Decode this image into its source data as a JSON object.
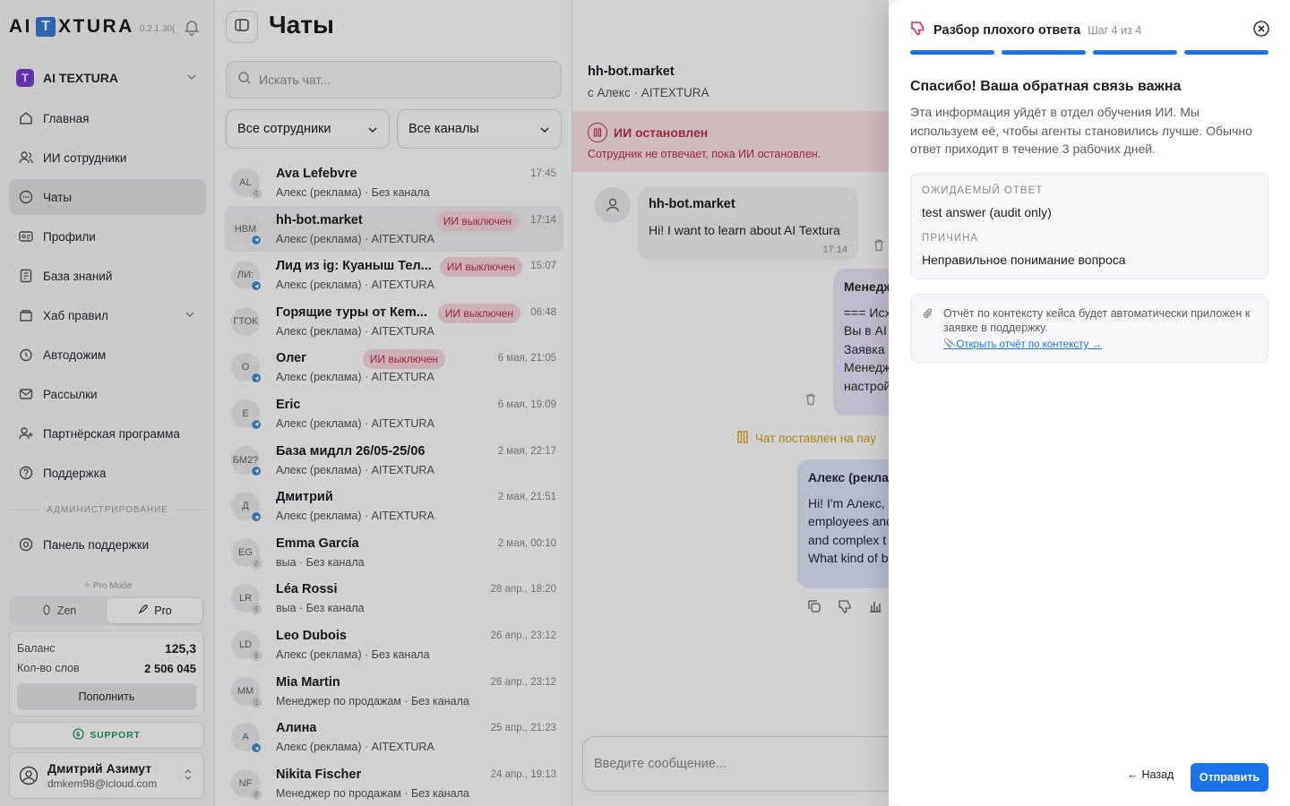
{
  "sidebar": {
    "logo_left": "AI",
    "logo_t": "T",
    "logo_right": "XTURA",
    "version": "0.2.1.30(",
    "workspace": {
      "badge": "T",
      "name": "AI TEXTURA"
    },
    "items": [
      {
        "label": "Главная",
        "icon": "home-icon"
      },
      {
        "label": "ИИ сотрудники",
        "icon": "users-icon"
      },
      {
        "label": "Чаты",
        "icon": "chat-icon"
      },
      {
        "label": "Профили",
        "icon": "profile-card-icon"
      },
      {
        "label": "База знаний",
        "icon": "book-icon"
      },
      {
        "label": "Хаб правил",
        "icon": "rules-icon"
      },
      {
        "label": "Автодожим",
        "icon": "clock-icon"
      },
      {
        "label": "Рассылки",
        "icon": "mail-icon"
      },
      {
        "label": "Партнёрская программа",
        "icon": "partner-icon"
      },
      {
        "label": "Поддержка",
        "icon": "help-icon"
      }
    ],
    "admin_label": "АДМИНИСТРИРОВАНИЕ",
    "admin_item": "Панель поддержки",
    "pro_mode_label": "Pro Mode",
    "mode_zen": "Zen",
    "mode_pro": "Pro",
    "balance_label": "Баланс",
    "balance_value": "125,3",
    "words_label": "Кол-во слов",
    "words_value": "2 506 045",
    "topup": "Пополнить",
    "support": "SUPPORT",
    "user_name": "Дмитрий Азимут",
    "user_email": "dmkem98@icloud.com"
  },
  "chatlist": {
    "title": "Чаты",
    "search_placeholder": "Искать чат...",
    "filter_employees": "Все сотрудники",
    "filter_channels": "Все каналы",
    "items": [
      {
        "initials": "AL",
        "name": "Ava Lefebvre",
        "sub": "Алекс (реклама) · Без канала",
        "time": "17:45",
        "badge": ""
      },
      {
        "initials": "НВМ",
        "name": "hh-bot.market",
        "sub": "Алекс (реклама) · AITEXTURA",
        "time": "17:14",
        "badge": "ИИ выключен"
      },
      {
        "initials": "ЛИ:",
        "name": "Лид из ig: Куаныш Тел...",
        "sub": "Алекс (реклама) · AITEXTURA",
        "time": "15:07",
        "badge": "ИИ выключен"
      },
      {
        "initials": "ГТОК",
        "name": "Горящие туры от Кem...",
        "sub": "Алекс (реклама) · AITEXTURA",
        "time": "06:48",
        "badge": "ИИ выключен"
      },
      {
        "initials": "О",
        "name": "Олег",
        "sub": "Алекс (реклама) · AITEXTURA",
        "time": "6 мая, 21:05",
        "badge": "ИИ выключен"
      },
      {
        "initials": "E",
        "name": "Eric",
        "sub": "Алекс (реклама) · AITEXTURA",
        "time": "6 мая, 19:09",
        "badge": ""
      },
      {
        "initials": "БМ2?",
        "name": "База мидлл 26/05-25/06",
        "sub": "Алекс (реклама) · AITEXTURA",
        "time": "2 мая, 22:17",
        "badge": ""
      },
      {
        "initials": "Д",
        "name": "Дмитрий",
        "sub": "Алекс (реклама) · AITEXTURA",
        "time": "2 мая, 21:51",
        "badge": ""
      },
      {
        "initials": "EG",
        "name": "Emma García",
        "sub": "выа · Без канала",
        "time": "2 мая, 00:10",
        "badge": ""
      },
      {
        "initials": "LR",
        "name": "Léa Rossi",
        "sub": "выа · Без канала",
        "time": "28 апр., 18:20",
        "badge": ""
      },
      {
        "initials": "LD",
        "name": "Leo Dubois",
        "sub": "Алекс (реклама) · Без канала",
        "time": "26 апр., 23:12",
        "badge": ""
      },
      {
        "initials": "MM",
        "name": "Mia Martin",
        "sub": "Менеджер по продажам · Без канала",
        "time": "26 апр., 23:12",
        "badge": ""
      },
      {
        "initials": "А",
        "name": "Алина",
        "sub": "Алекс (реклама) · AITEXTURA",
        "time": "25 апр., 21:23",
        "badge": ""
      },
      {
        "initials": "NF",
        "name": "Nikita Fischer",
        "sub": "Менеджер по продажам · Без канала",
        "time": "24 апр., 19:13",
        "badge": ""
      }
    ]
  },
  "conversation": {
    "title": "hh-bot.market",
    "subtitle": "с Алекс · AITEXTURA",
    "stopped_title": "ИИ остановлен",
    "stopped_desc": "Сотрудник не отвечает, пока ИИ остановлен.",
    "in_name": "hh-bot.market",
    "in_text": "Hi! I want to learn about AI Textura",
    "in_time": "17:14",
    "purple_lines": [
      "Менедж",
      "=== Исх",
      "Вы в AI",
      "Заявка",
      "Менедж",
      "настрой"
    ],
    "pause_text": "Чат поставлен на пау",
    "blue_lines": [
      "Алекс (рекла",
      "Hi! I'm Алекс,",
      "employees and",
      "and complex t",
      "What kind of b"
    ],
    "composer_placeholder": "Введите сообщение..."
  },
  "panel": {
    "title": "Разбор плохого ответа",
    "step": "Шаг 4 из 4",
    "heading": "Спасибо! Ваша обратная связь важна",
    "description": "Эта информация уйдёт в отдел обучения ИИ. Мы используем её, чтобы агенты становились лучше. Обычно ответ приходит в течение 3 рабочих дней.",
    "expected_label": "ОЖИДАЕМЫЙ ОТВЕТ",
    "expected_value": "test answer (audit only)",
    "reason_label": "ПРИЧИНА",
    "reason_value": "Неправильное понимание вопроса",
    "attach_text": "Отчёт по контексту кейса будет автоматически приложен к заявке в поддержку.",
    "attach_link": "📎Открыть отчёт по контексту →",
    "back": "Назад",
    "send": "Отправить",
    "accent": "#1a73e8"
  }
}
